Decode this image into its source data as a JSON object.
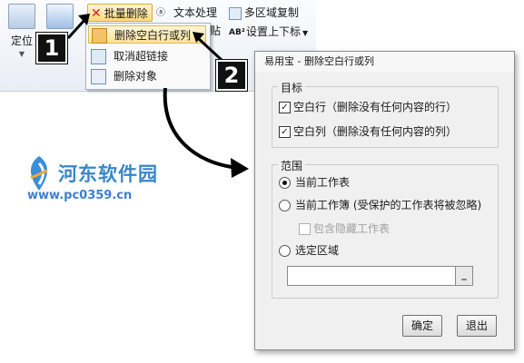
{
  "ribbon": {
    "locate_label": "定位",
    "batch_delete_label": "批量删除",
    "text_process_label": "文本处理",
    "multi_area_copy_label": "多区域复制",
    "paste_partial": "贴",
    "settings_label": "设置上下标",
    "colors": {
      "batch_bg": "#ffd97a",
      "delete_x": "#d42020"
    }
  },
  "dropdown": {
    "items": [
      {
        "label": "删除空白行或列",
        "icon": "delete-blank-rows-icon",
        "selected": true
      },
      {
        "label": "取消超链接",
        "icon": "unlink-icon",
        "selected": false
      },
      {
        "label": "删除对象",
        "icon": "delete-object-icon",
        "selected": false
      }
    ]
  },
  "callouts": {
    "step1": "1",
    "step2": "2"
  },
  "dialog": {
    "title": "易用宝 - 删除空白行或列",
    "target_group": "目标",
    "blank_rows": "空白行（删除没有任何内容的行）",
    "blank_rows_checked": true,
    "blank_cols": "空白列（删除没有任何内容的列）",
    "blank_cols_checked": true,
    "scope_group": "范围",
    "current_sheet": "当前工作表",
    "current_workbook": "当前工作簿 (受保护的工作表将被忽略)",
    "include_hidden": "包含隐藏工作表",
    "selected_range": "选定区域",
    "selected_scope": "current_sheet",
    "range_value": "",
    "range_button": "_",
    "ok": "确定",
    "exit": "退出"
  },
  "watermark": {
    "site_name": "河东软件园",
    "url": "www.pc0359.cn"
  }
}
